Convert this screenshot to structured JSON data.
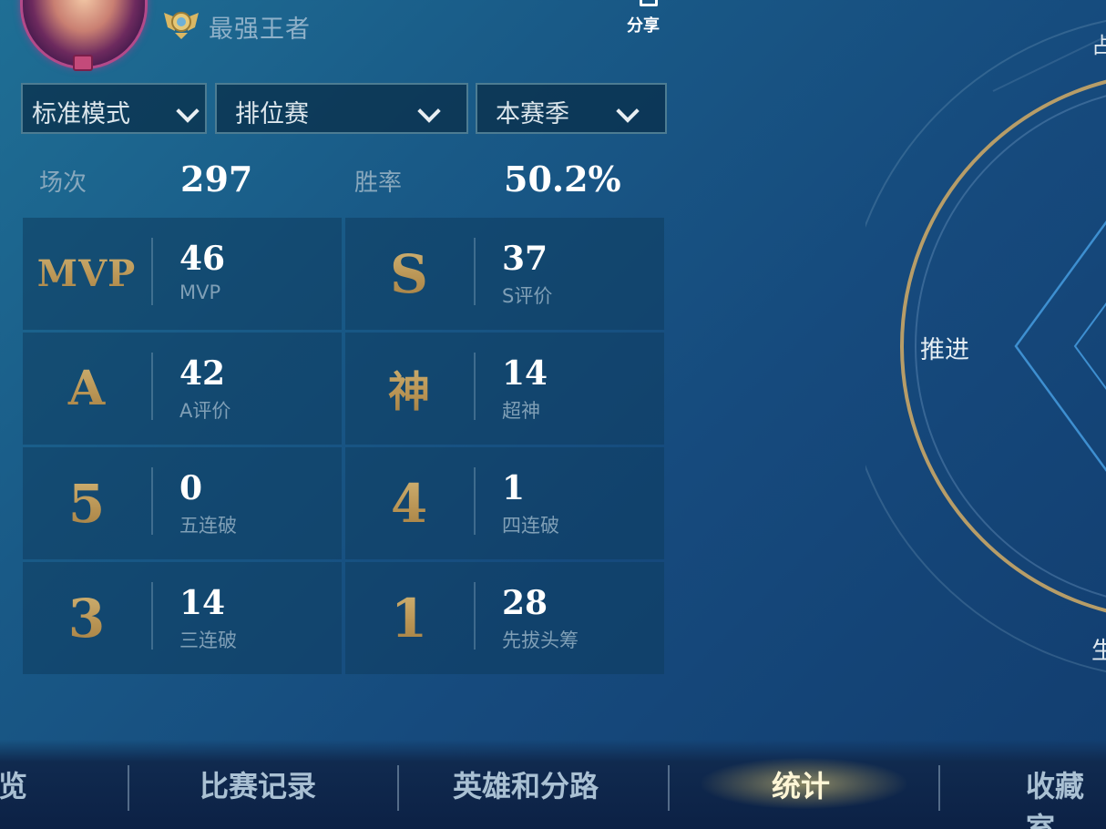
{
  "header": {
    "rank_label": "最强王者",
    "share_label": "分享",
    "corner_top_char": "占",
    "corner_bottom_char": "生"
  },
  "filters": {
    "mode": "标准模式",
    "match_type": "排位赛",
    "season": "本赛季"
  },
  "summary": {
    "games_label": "场次",
    "games_value": "297",
    "winrate_label": "胜率",
    "winrate_value": "50.2%"
  },
  "stats": [
    {
      "badge": "MVP",
      "value": "46",
      "label": "MVP"
    },
    {
      "badge": "S",
      "value": "37",
      "label": "S评价"
    },
    {
      "badge": "A",
      "value": "42",
      "label": "A评价"
    },
    {
      "badge": "神",
      "value": "14",
      "label": "超神"
    },
    {
      "badge": "5",
      "value": "0",
      "label": "五连破"
    },
    {
      "badge": "4",
      "value": "1",
      "label": "四连破"
    },
    {
      "badge": "3",
      "value": "14",
      "label": "三连破"
    },
    {
      "badge": "1",
      "value": "28",
      "label": "先拔头筹"
    }
  ],
  "radar": {
    "label_push": "推进"
  },
  "nav": {
    "items": [
      "览",
      "比赛记录",
      "英雄和分路",
      "统计",
      "收藏室"
    ],
    "active": "统计"
  },
  "colors": {
    "accent_gold": "#c4a566",
    "background": "#195a87"
  }
}
